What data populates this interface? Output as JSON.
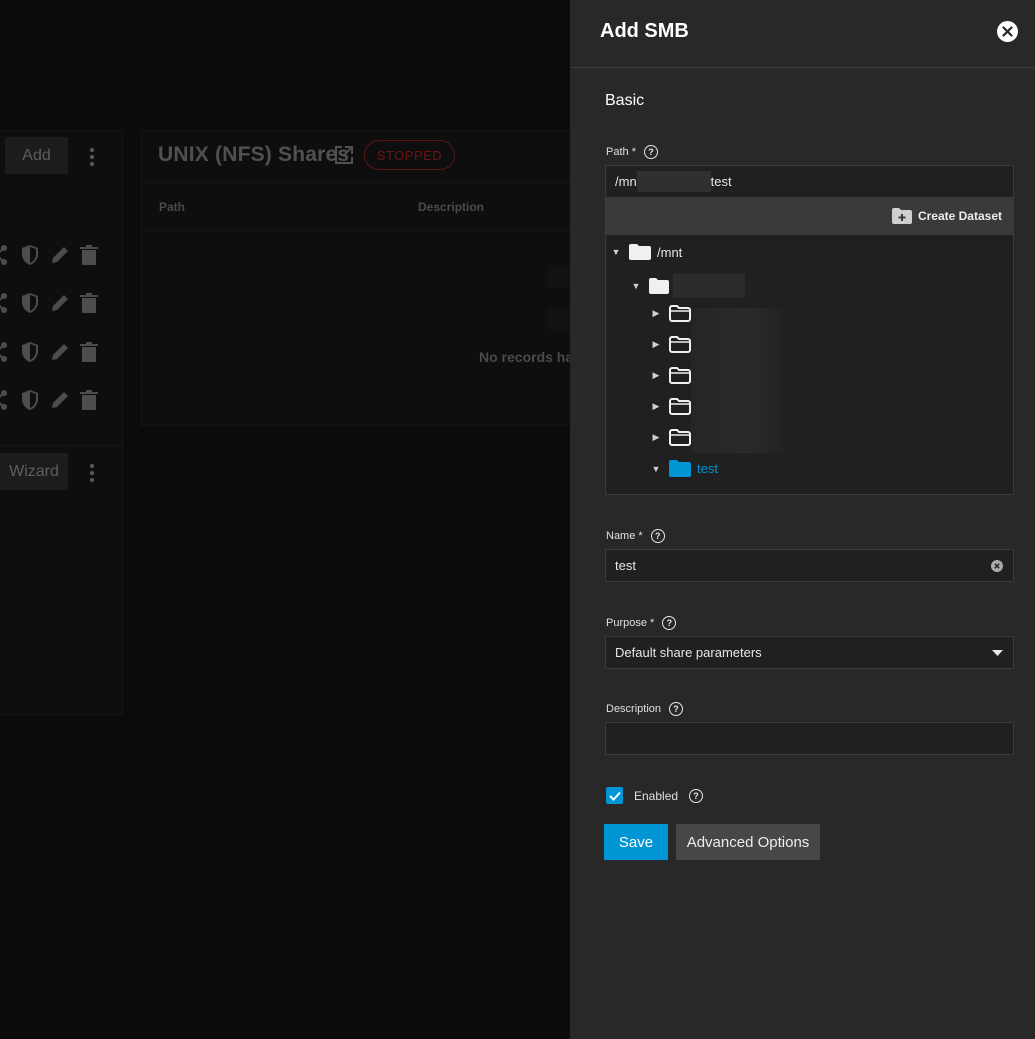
{
  "background": {
    "add_button": "Add",
    "wizard_button": "Wizard",
    "nfs_title": "UNIX (NFS) Shares",
    "status_badge": "STOPPED",
    "columns": [
      "Path",
      "Description"
    ],
    "empty_text": "No records ha"
  },
  "panel": {
    "title": "Add SMB",
    "section_basic": "Basic",
    "path": {
      "label": "Path",
      "required_mark": "*",
      "value_prefix": "/mn",
      "value_suffix": "test"
    },
    "explorer": {
      "create_dataset_label": "Create Dataset",
      "root": "/mnt",
      "selected_node": "test",
      "collapsed_folders": 5
    },
    "name": {
      "label": "Name",
      "required_mark": "*",
      "value": "test"
    },
    "purpose": {
      "label": "Purpose",
      "required_mark": "*",
      "value": "Default share parameters"
    },
    "description": {
      "label": "Description",
      "value": ""
    },
    "enabled": {
      "label": "Enabled",
      "checked": true
    },
    "save_button": "Save",
    "advanced_button": "Advanced Options"
  },
  "colors": {
    "accent": "#0095d5",
    "panel_bg": "#282828",
    "input_bg": "#202020",
    "stopped_badge": "#6a1414"
  },
  "icons": [
    "close-icon",
    "help-icon",
    "add-folder-icon",
    "folder-icon",
    "caret-down-icon",
    "caret-right-icon",
    "clear-icon",
    "dropdown-arrow-icon",
    "check-icon",
    "shield-icon",
    "pencil-icon",
    "trash-icon",
    "share-icon",
    "external-link-icon",
    "more-vert-icon"
  ]
}
